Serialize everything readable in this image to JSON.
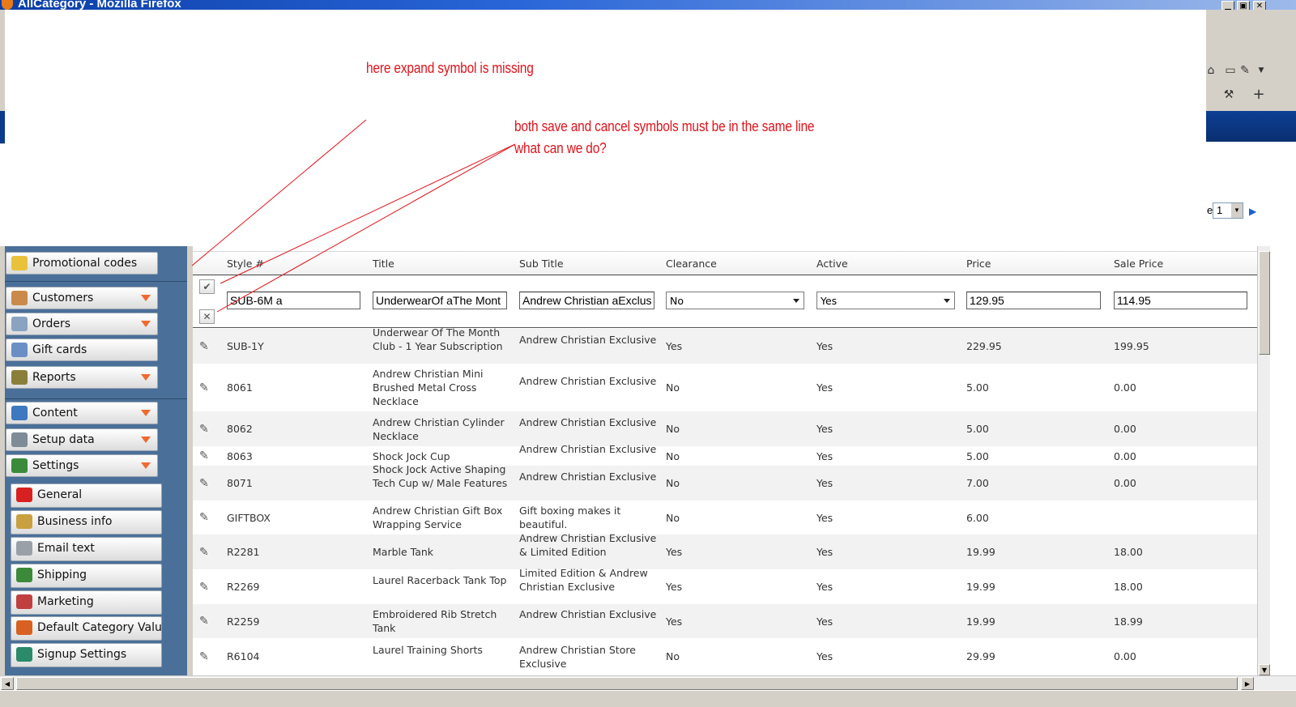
{
  "window": {
    "title": "AllCategory - Mozilla Firefox",
    "min_label": "▁",
    "max_label": "▣",
    "close_label": "✕"
  },
  "pager": {
    "label": "e:",
    "value": "1"
  },
  "annotations": [
    "here expand symbol is missing",
    "both save and cancel symbols must be in the same line",
    "what can we do?"
  ],
  "colors": {
    "annotation": "#e0141c",
    "sidebar": "#4a6f98",
    "caret": "#f06a2e"
  },
  "sidebar": {
    "top_items": [
      {
        "label": "Promotional codes",
        "icon": "sun-icon"
      },
      {
        "label": "Customers",
        "icon": "people-icon",
        "expandable": true
      },
      {
        "label": "Orders",
        "icon": "orders-icon",
        "expandable": true
      },
      {
        "label": "Gift cards",
        "icon": "gift-card-icon"
      },
      {
        "label": "Reports",
        "icon": "report-icon",
        "expandable": true
      },
      {
        "label": "Content",
        "icon": "content-icon",
        "expandable": true
      },
      {
        "label": "Setup data",
        "icon": "gears-icon",
        "expandable": true
      },
      {
        "label": "Settings",
        "icon": "settings-icon",
        "expandable": true
      }
    ],
    "settings_items": [
      {
        "label": "General",
        "icon": "general-icon"
      },
      {
        "label": "Business info",
        "icon": "business-icon"
      },
      {
        "label": "Email text",
        "icon": "email-icon"
      },
      {
        "label": "Shipping",
        "icon": "shipping-icon"
      },
      {
        "label": "Marketing",
        "icon": "marketing-icon"
      },
      {
        "label": "Default Category Values",
        "icon": "category-icon"
      },
      {
        "label": "Signup Settings",
        "icon": "signup-icon"
      }
    ]
  },
  "grid": {
    "columns": [
      "Style #",
      "Title",
      "Sub Title",
      "Clearance",
      "Active",
      "Price",
      "Sale Price"
    ],
    "edit_row": {
      "save_icon": "✔",
      "cancel_icon": "✕",
      "style": "SUB-6M a",
      "title": "UnderwearOf aThe Mont",
      "subtitle": "Andrew Christian aExclus",
      "clearance": "No",
      "active": "Yes",
      "price": "129.95",
      "sale_price": "114.95"
    },
    "rows": [
      {
        "style": "SUB-1Y",
        "title": "Underwear Of The Month Club - 1 Year Subscription",
        "subtitle": "Andrew Christian Exclusive",
        "clearance": "Yes",
        "active": "Yes",
        "price": "229.95",
        "sale_price": "199.95"
      },
      {
        "style": "8061",
        "title": "Andrew Christian Mini Brushed Metal Cross Necklace",
        "subtitle": "Andrew Christian Exclusive",
        "clearance": "No",
        "active": "Yes",
        "price": "5.00",
        "sale_price": "0.00"
      },
      {
        "style": "8062",
        "title": "Andrew Christian Cylinder Necklace",
        "subtitle": "Andrew Christian Exclusive",
        "clearance": "No",
        "active": "Yes",
        "price": "5.00",
        "sale_price": "0.00"
      },
      {
        "style": "8063",
        "title": "Shock Jock Cup",
        "subtitle": "Andrew Christian Exclusive",
        "clearance": "No",
        "active": "Yes",
        "price": "5.00",
        "sale_price": "0.00"
      },
      {
        "style": "8071",
        "title": "Shock Jock Active Shaping Tech Cup w/ Male Features",
        "subtitle": "Andrew Christian Exclusive",
        "clearance": "No",
        "active": "Yes",
        "price": "7.00",
        "sale_price": "0.00"
      },
      {
        "style": "GIFTBOX",
        "title": "Andrew Christian Gift Box Wrapping Service",
        "subtitle": "Gift boxing makes it beautiful.",
        "clearance": "No",
        "active": "Yes",
        "price": "6.00",
        "sale_price": ""
      },
      {
        "style": "R2281",
        "title": "Marble Tank",
        "subtitle": "Andrew Christian Exclusive & Limited Edition",
        "clearance": "Yes",
        "active": "Yes",
        "price": "19.99",
        "sale_price": "18.00"
      },
      {
        "style": "R2269",
        "title": "Laurel Racerback Tank Top",
        "subtitle": "Limited Edition & Andrew Christian Exclusive",
        "clearance": "Yes",
        "active": "Yes",
        "price": "19.99",
        "sale_price": "18.00"
      },
      {
        "style": "R2259",
        "title": "Embroidered Rib Stretch Tank",
        "subtitle": "Andrew Christian Exclusive",
        "clearance": "Yes",
        "active": "Yes",
        "price": "19.99",
        "sale_price": "18.99"
      },
      {
        "style": "R6104",
        "title": "Laurel Training Shorts",
        "subtitle": "Andrew Christian Store Exclusive",
        "clearance": "No",
        "active": "Yes",
        "price": "29.99",
        "sale_price": "0.00"
      }
    ]
  }
}
